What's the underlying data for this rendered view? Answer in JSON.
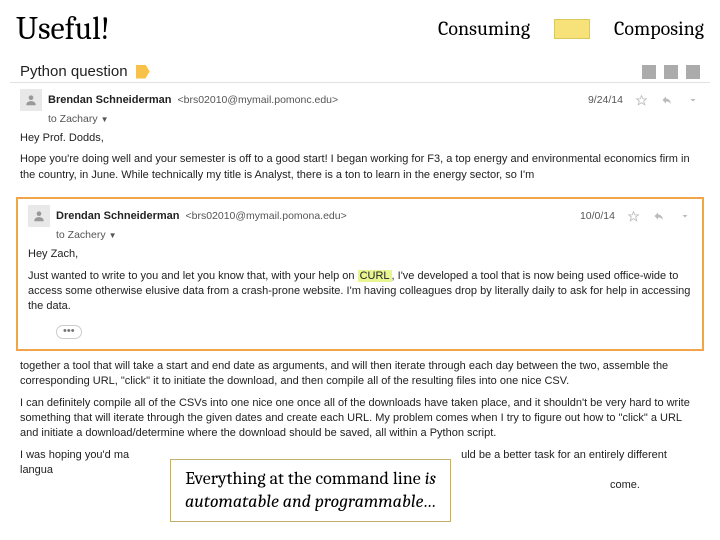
{
  "header": {
    "title": "Useful!",
    "consuming": "Consuming",
    "composing": "Composing"
  },
  "subject": "Python question",
  "messages": [
    {
      "sender": "Brendan Schneiderman",
      "email": "<brs02010@mymail.pomonc.edu>",
      "date": "9/24/14",
      "to": "to Zachary",
      "greeting": "Hey Prof. Dodds,",
      "para1": "Hope you're doing well and your semester is off to a good start! I began working for F3, a top energy and environmental economics firm in the country, in June. While technically my title is Analyst, there is a ton to learn in the energy sector, so I'm"
    },
    {
      "sender": "Drendan Schneiderman",
      "email": "<brs02010@mymail.pomona.edu>",
      "date": "10/0/14",
      "to": "to Zachery",
      "greeting": "Hey Zach,",
      "para1_a": "Just wanted to write to you and let you know that, with your help on ",
      "curl": "CURL",
      "para1_b": ", I've developed a tool that is now being used office-wide to access some otherwise elusive data from a crash-prone website. I'm having colleagues drop by literally daily to ask for help in accessing the data."
    }
  ],
  "trailing": {
    "para1": "together a tool that will take a start and end date as arguments, and will then iterate through each day between the two, assemble the corresponding URL, \"click\" it to initiate the download, and then compile all of the resulting files into one nice CSV.",
    "para2": "I can definitely compile all of the CSVs into one nice one once all of the downloads have taken place, and it shouldn't be very hard to write something that will iterate through the given dates and create each URL. My problem comes when I try to figure out how to \"click\" a URL and initiate a download/determine where the download should be saved, all within a Python script.",
    "para3a": "I was hoping you'd ma",
    "para3b": "uld be a better task for an entirely different langua",
    "para3c": "come."
  },
  "callout": {
    "line1a": "Everything at the command line ",
    "line1b": "is",
    "line2": "automatable and programmable…"
  }
}
